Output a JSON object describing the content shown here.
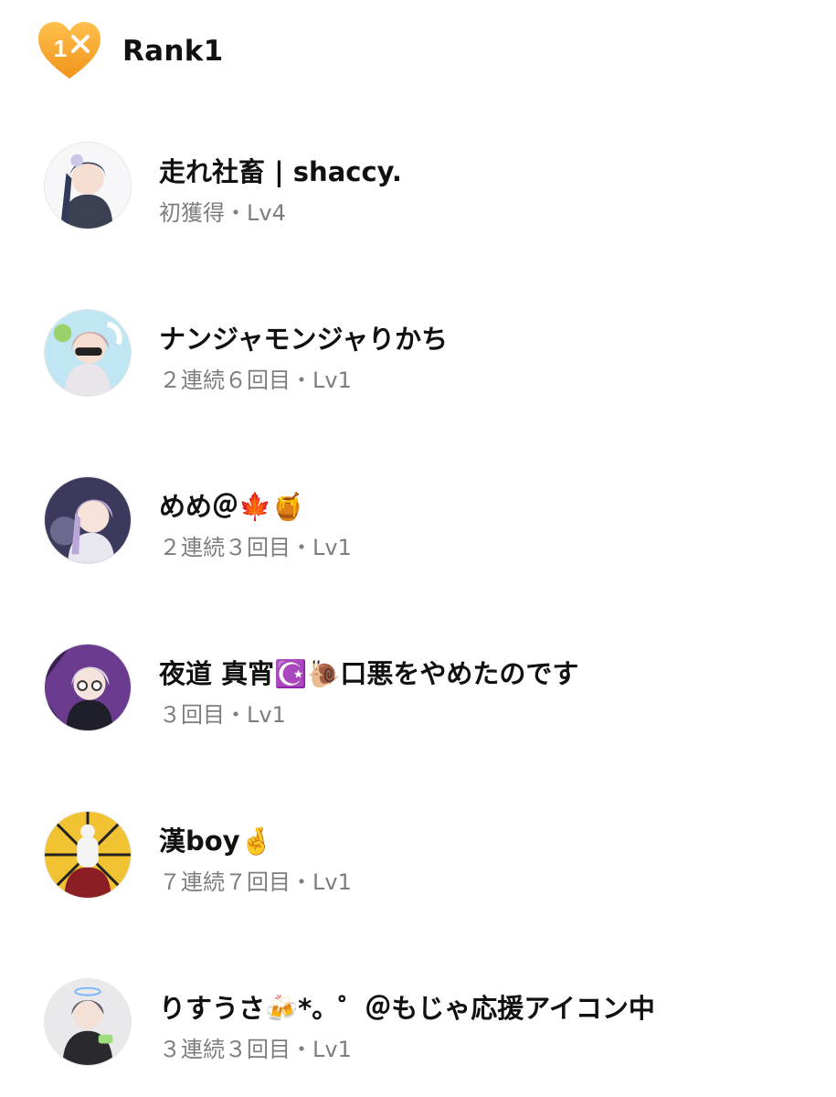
{
  "header": {
    "badge_number": "1",
    "title": "Rank1",
    "badge_color": "#f5a623"
  },
  "users": [
    {
      "name": "走れ社畜 | shaccy.",
      "meta": "初獲得・Lv4",
      "avatar": "user-avatar-image"
    },
    {
      "name": "ナンジャモンジャりかち",
      "meta": "２連続６回目・Lv1",
      "avatar": "user-avatar-image"
    },
    {
      "name": "めめ＠🍁🍯",
      "meta": "２連続３回目・Lv1",
      "avatar": "user-avatar-image"
    },
    {
      "name": "夜道 真宵☪️🐌口悪をやめたのです",
      "meta": "３回目・Lv1",
      "avatar": "user-avatar-image"
    },
    {
      "name": "漢boy🤞",
      "meta": "７連続７回目・Lv1",
      "avatar": "user-avatar-image"
    },
    {
      "name": "りすうさ🍻*。゜＠もじゃ応援アイコン中",
      "meta": "３連続３回目・Lv1",
      "avatar": "user-avatar-image"
    }
  ]
}
